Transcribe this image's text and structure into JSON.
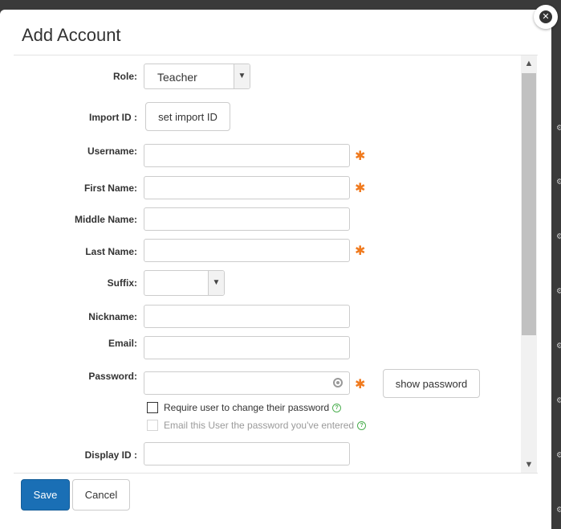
{
  "modal": {
    "title": "Add Account",
    "close_icon": "close-icon"
  },
  "form": {
    "role": {
      "label": "Role:",
      "selected": "Teacher"
    },
    "import_id": {
      "label": "Import ID :",
      "button": "set import ID"
    },
    "username": {
      "label": "Username:",
      "value": "",
      "required": true
    },
    "first_name": {
      "label": "First Name:",
      "value": "",
      "required": true
    },
    "middle_name": {
      "label": "Middle Name:",
      "value": ""
    },
    "last_name": {
      "label": "Last Name:",
      "value": "",
      "required": true
    },
    "suffix": {
      "label": "Suffix:",
      "selected": ""
    },
    "nickname": {
      "label": "Nickname:",
      "value": ""
    },
    "email": {
      "label": "Email:",
      "value": ""
    },
    "password": {
      "label": "Password:",
      "value": "",
      "required": true,
      "show_button": "show password"
    },
    "require_change": {
      "label": "Require user to change their password",
      "checked": false
    },
    "email_password": {
      "label": "Email this User the password you've entered",
      "checked": false,
      "disabled": true
    },
    "display_id": {
      "label": "Display ID :",
      "value": ""
    },
    "required_marker": "✱"
  },
  "footer": {
    "save": "Save",
    "cancel": "Cancel"
  },
  "colors": {
    "primary": "#1a6fb5",
    "required": "#f07a1e",
    "help": "#4caf50"
  }
}
